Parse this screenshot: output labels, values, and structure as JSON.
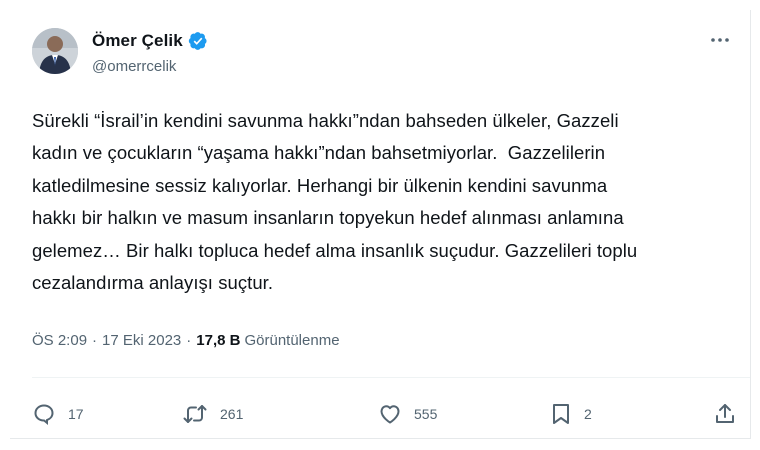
{
  "author": {
    "display_name": "Ömer Çelik",
    "handle": "@omerrcelik",
    "verified": true
  },
  "tweet": {
    "text": "Sürekli “İsrail’in kendini savunma hakkı”ndan bahseden ülkeler, Gazzeli\nkadın ve çocukların “yaşama hakkı”ndan bahsetmiyorlar.  Gazzelilerin\nkatledilmesine sessiz kalıyorlar. Herhangi bir ülkenin kendini savunma\nhakkı bir halkın ve masum insanların topyekun hedef alınması anlamına\ngelemez… Bir halkı topluca hedef alma insanlık suçudur. Gazzelileri toplu\ncezalandırma anlayışı suçtur.",
    "time": "ÖS 2:09",
    "date": "17 Eki 2023",
    "separator": "·",
    "views_count": "17,8 B",
    "views_label": "Görüntülenme"
  },
  "actions": {
    "replies": "17",
    "reposts": "261",
    "likes": "555",
    "bookmarks": "2"
  },
  "colors": {
    "verified": "#1d9bf0",
    "icon": "#536471",
    "text": "#0f1419",
    "secondary": "#536471"
  },
  "icons": {
    "verified": "verified-badge-icon",
    "more": "more-horizontal-icon",
    "reply": "reply-icon",
    "repost": "repost-icon",
    "like": "heart-icon",
    "bookmark": "bookmark-icon",
    "share": "share-icon"
  }
}
